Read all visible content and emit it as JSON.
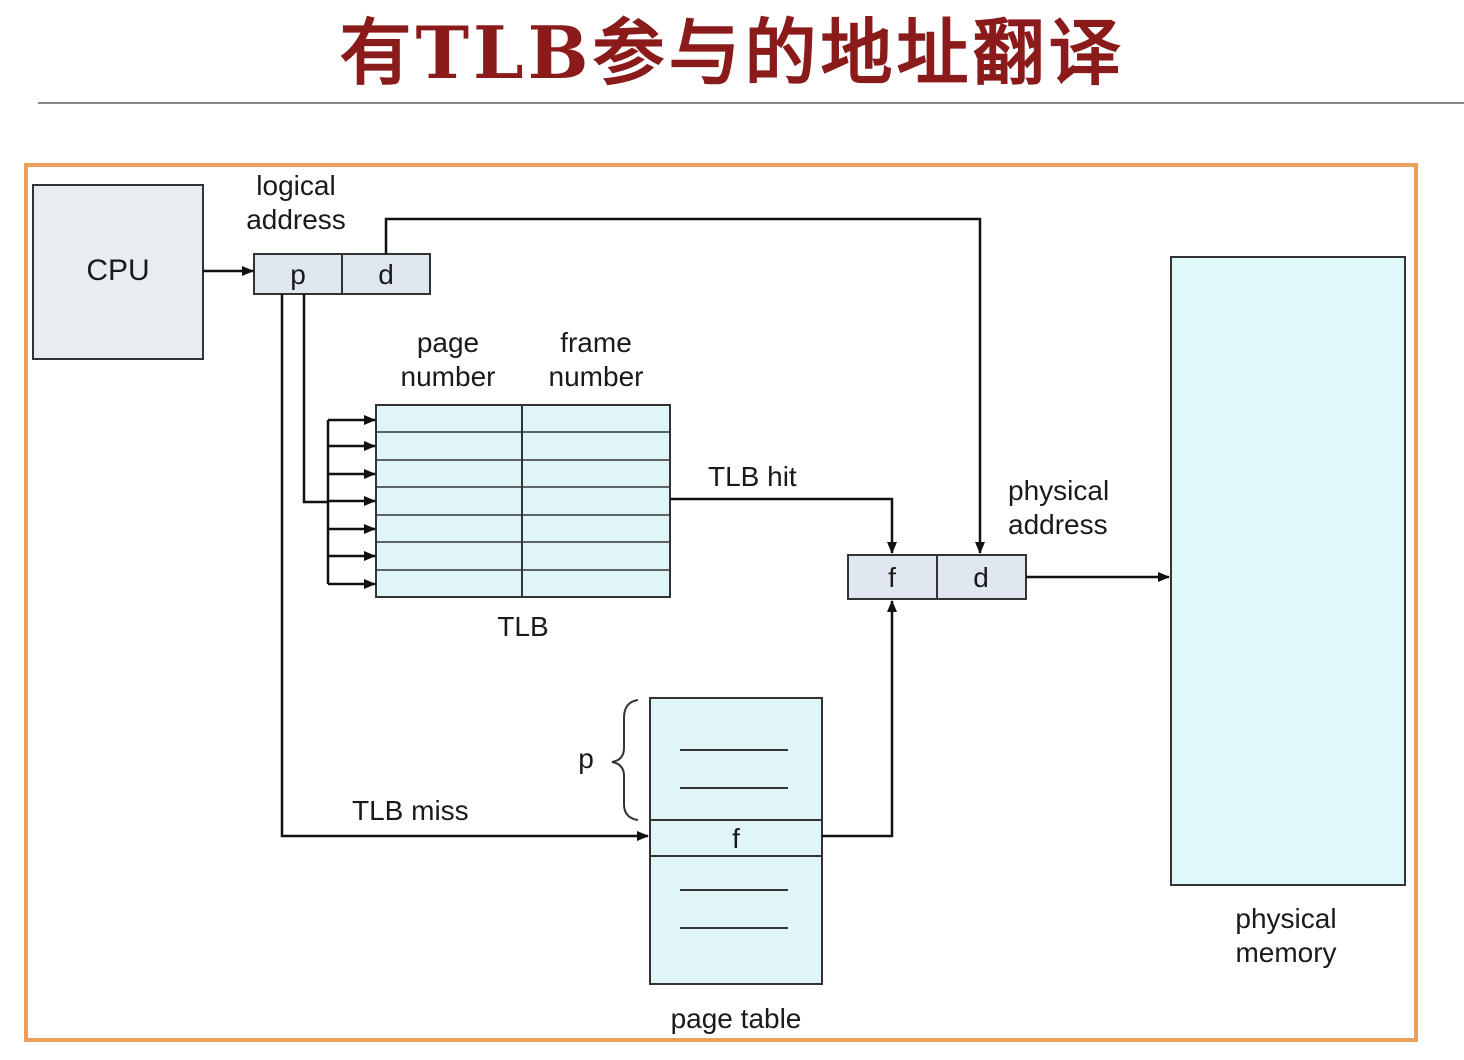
{
  "slide": {
    "title": "有TLB参与的地址翻译"
  },
  "diagram": {
    "cpu_label": "CPU",
    "logical_address_label": [
      "logical",
      "address"
    ],
    "logical_fields": {
      "p": "p",
      "d": "d"
    },
    "tlb_headers": {
      "page": [
        "page",
        "number"
      ],
      "frame": [
        "frame",
        "number"
      ]
    },
    "tlb_label": "TLB",
    "tlb_hit_label": "TLB hit",
    "tlb_miss_label": "TLB miss",
    "physical_address_label": [
      "physical",
      "address"
    ],
    "physical_fields": {
      "f": "f",
      "d": "d"
    },
    "page_table_label": "page table",
    "page_table_p": "p",
    "page_table_f": "f",
    "physical_memory_label": [
      "physical",
      "memory"
    ],
    "colors": {
      "title": "#8b1a1a",
      "frame_border": "#e8a05a",
      "cell_fill": "#dfe8f0",
      "table_fill": "#dff5f8",
      "memory_fill": "#e0fafc",
      "cpu_fill": "#e8edf2"
    }
  }
}
